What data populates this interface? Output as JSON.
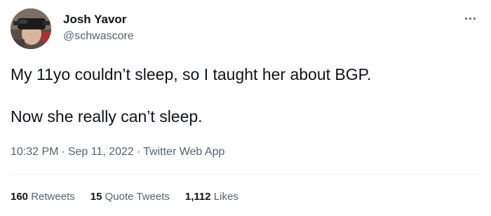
{
  "author": {
    "name": "Josh Yavor",
    "handle": "@schwascore"
  },
  "more_icon": "more-horizontal-icon",
  "tweet": {
    "line1": "My 11yo couldn’t sleep, so I taught her about BGP.",
    "line2": "Now she really can’t sleep."
  },
  "meta": {
    "time": "10:32 PM",
    "separator": "·",
    "date": "Sep 11, 2022",
    "source": "Twitter Web App"
  },
  "stats": {
    "retweets_count": "160",
    "retweets_label": "Retweets",
    "quotes_count": "15",
    "quotes_label": "Quote Tweets",
    "likes_count": "1,112",
    "likes_label": "Likes"
  },
  "colors": {
    "text_primary": "#0f1419",
    "text_secondary": "#536471",
    "divider": "#eff3f4"
  }
}
